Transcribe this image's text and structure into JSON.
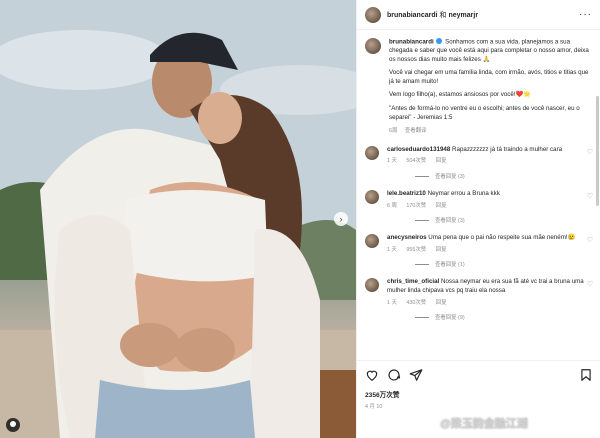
{
  "header": {
    "user1": "brunabiancardi",
    "connector": "和",
    "user2": "neymarjr"
  },
  "caption": {
    "username": "brunabiancardi",
    "p1": "Sonhamos com a sua vida, planejamos a sua chegada e saber que você está aqui para completar o nosso amor, deixa os nossos dias muito mais felizes 🙏",
    "p2": "Você vai chegar em uma família linda, com irmão, avós, titios e titias que já te amam muito!",
    "p3": "Vem logo filho(a), estamos ansiosos por você!❤️🌟",
    "p4": "\"Antes de formá-lo no ventre eu o escolhi; antes de você nascer, eu o separei\" - Jeremias 1:5",
    "age": "6周",
    "translate": "查看翻译"
  },
  "comments": [
    {
      "username": "carloseduardo131948",
      "text": "Rapazzzzzzz já tá traindo a mulher cara",
      "age": "1 天",
      "likes": "504次赞",
      "reply": "回复",
      "replies": "查看回复 (3)"
    },
    {
      "username": "lele.beatriz10",
      "text": "Neymar errou a Bruna kkk",
      "age": "6 周",
      "likes": "170次赞",
      "reply": "回复",
      "replies": "查看回复 (3)"
    },
    {
      "username": "anecysneiros",
      "text": "Uma pena que o pai não respeite sua mãe neném!😢",
      "age": "1 天",
      "likes": "955次赞",
      "reply": "回复",
      "replies": "查看回复 (1)"
    },
    {
      "username": "chris_time_oficial",
      "text": "Nossa neymar eu era sua fã até vc trai a bruna uma mulher linda chipava vcs pq traiu ela nossa",
      "age": "1 天",
      "likes": "430次赞",
      "reply": "回复",
      "replies": "查看回复 (9)"
    }
  ],
  "footer": {
    "likes": "2356万次赞",
    "date": "4 月 10"
  },
  "watermark": "@梁玉韵金融江湖",
  "icons": [
    "more-icon",
    "heart-icon",
    "comment-icon",
    "share-icon",
    "bookmark-icon",
    "next-arrow-icon",
    "tag-icon",
    "verified-icon"
  ],
  "colors": {
    "link": "#3897f0",
    "muted": "#8e8e8e",
    "text": "#262626"
  }
}
